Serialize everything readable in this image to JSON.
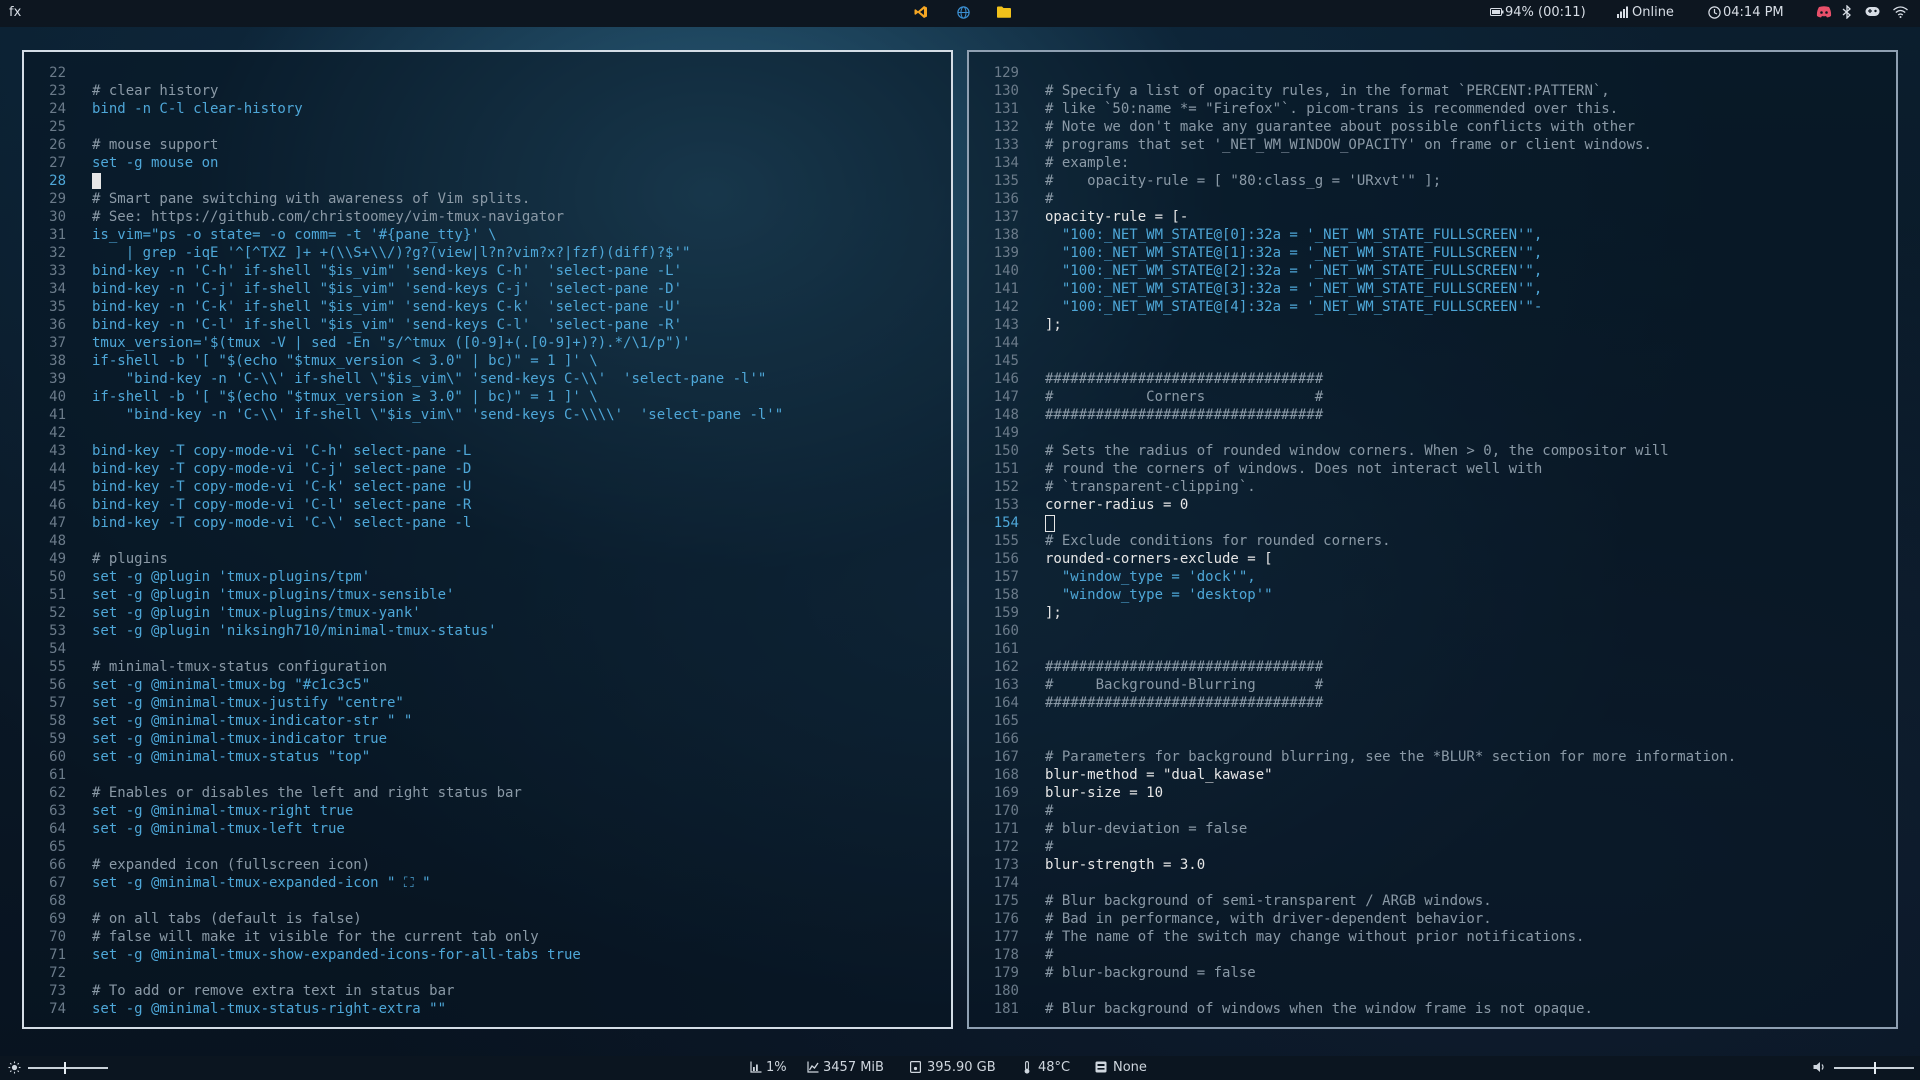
{
  "topbar": {
    "app_label": "fx",
    "battery": "94% (00:11)",
    "network": "Online",
    "clock": "04:14 PM"
  },
  "bottombar": {
    "cpu": "1%",
    "memory": "3457 MiB",
    "disk": "395.90 GB",
    "temp": "48°C",
    "keyboard": "None",
    "brightness_level": 0.45,
    "volume_level": 0.5
  },
  "left_pane": {
    "lines": [
      {
        "n": "22",
        "t": "",
        "c": "kw"
      },
      {
        "n": "23",
        "t": "# clear history",
        "c": "comment"
      },
      {
        "n": "24",
        "t": "bind -n C-l clear-history",
        "c": "cmd"
      },
      {
        "n": "25",
        "t": "",
        "c": "kw"
      },
      {
        "n": "26",
        "t": "# mouse support",
        "c": "comment"
      },
      {
        "n": "27",
        "t": "set -g mouse on",
        "c": "cmd"
      },
      {
        "n": "28",
        "t": "",
        "c": "cursor"
      },
      {
        "n": "29",
        "t": "# Smart pane switching with awareness of Vim splits.",
        "c": "comment"
      },
      {
        "n": "30",
        "t": "# See: https://github.com/christoomey/vim-tmux-navigator",
        "c": "comment"
      },
      {
        "n": "31",
        "t": "is_vim=\"ps -o state= -o comm= -t '#{pane_tty}' \\",
        "c": "mixed"
      },
      {
        "n": "32",
        "t": "    | grep -iqE '^[^TXZ ]+ +(\\\\S+\\\\/)?g?(view|l?n?vim?x?|fzf)(diff)?$'\"",
        "c": "mixed"
      },
      {
        "n": "33",
        "t": "bind-key -n 'C-h' if-shell \"$is_vim\" 'send-keys C-h'  'select-pane -L'",
        "c": "mixed"
      },
      {
        "n": "34",
        "t": "bind-key -n 'C-j' if-shell \"$is_vim\" 'send-keys C-j'  'select-pane -D'",
        "c": "mixed"
      },
      {
        "n": "35",
        "t": "bind-key -n 'C-k' if-shell \"$is_vim\" 'send-keys C-k'  'select-pane -U'",
        "c": "mixed"
      },
      {
        "n": "36",
        "t": "bind-key -n 'C-l' if-shell \"$is_vim\" 'send-keys C-l'  'select-pane -R'",
        "c": "mixed"
      },
      {
        "n": "37",
        "t": "tmux_version='$(tmux -V | sed -En \"s/^tmux ([0-9]+(.[0-9]+)?).*/\\1/p\")'",
        "c": "mixed"
      },
      {
        "n": "38",
        "t": "if-shell -b '[ \"$(echo \"$tmux_version < 3.0\" | bc)\" = 1 ]' \\",
        "c": "mixed"
      },
      {
        "n": "39",
        "t": "    \"bind-key -n 'C-\\\\' if-shell \\\"$is_vim\\\" 'send-keys C-\\\\'  'select-pane -l'\"",
        "c": "mixed"
      },
      {
        "n": "40",
        "t": "if-shell -b '[ \"$(echo \"$tmux_version ≥ 3.0\" | bc)\" = 1 ]' \\",
        "c": "mixed"
      },
      {
        "n": "41",
        "t": "    \"bind-key -n 'C-\\\\' if-shell \\\"$is_vim\\\" 'send-keys C-\\\\\\\\'  'select-pane -l'\"",
        "c": "mixed"
      },
      {
        "n": "42",
        "t": "",
        "c": "kw"
      },
      {
        "n": "43",
        "t": "bind-key -T copy-mode-vi 'C-h' select-pane -L",
        "c": "mixed"
      },
      {
        "n": "44",
        "t": "bind-key -T copy-mode-vi 'C-j' select-pane -D",
        "c": "mixed"
      },
      {
        "n": "45",
        "t": "bind-key -T copy-mode-vi 'C-k' select-pane -U",
        "c": "mixed"
      },
      {
        "n": "46",
        "t": "bind-key -T copy-mode-vi 'C-l' select-pane -R",
        "c": "mixed"
      },
      {
        "n": "47",
        "t": "bind-key -T copy-mode-vi 'C-\\' select-pane -l",
        "c": "mixed"
      },
      {
        "n": "48",
        "t": "",
        "c": "kw"
      },
      {
        "n": "49",
        "t": "# plugins",
        "c": "comment"
      },
      {
        "n": "50",
        "t": "set -g @plugin 'tmux-plugins/tpm'",
        "c": "mixed"
      },
      {
        "n": "51",
        "t": "set -g @plugin 'tmux-plugins/tmux-sensible'",
        "c": "mixed"
      },
      {
        "n": "52",
        "t": "set -g @plugin 'tmux-plugins/tmux-yank'",
        "c": "mixed"
      },
      {
        "n": "53",
        "t": "set -g @plugin 'niksingh710/minimal-tmux-status'",
        "c": "mixed"
      },
      {
        "n": "54",
        "t": "",
        "c": "kw"
      },
      {
        "n": "55",
        "t": "# minimal-tmux-status configuration",
        "c": "comment"
      },
      {
        "n": "56",
        "t": "set -g @minimal-tmux-bg \"#c1c3c5\"",
        "c": "mixed"
      },
      {
        "n": "57",
        "t": "set -g @minimal-tmux-justify \"centre\"",
        "c": "mixed"
      },
      {
        "n": "58",
        "t": "set -g @minimal-tmux-indicator-str \" \"",
        "c": "mixed"
      },
      {
        "n": "59",
        "t": "set -g @minimal-tmux-indicator true",
        "c": "mixed"
      },
      {
        "n": "60",
        "t": "set -g @minimal-tmux-status \"top\"",
        "c": "mixed"
      },
      {
        "n": "61",
        "t": "",
        "c": "kw"
      },
      {
        "n": "62",
        "t": "# Enables or disables the left and right status bar",
        "c": "comment"
      },
      {
        "n": "63",
        "t": "set -g @minimal-tmux-right true",
        "c": "mixed"
      },
      {
        "n": "64",
        "t": "set -g @minimal-tmux-left true",
        "c": "mixed"
      },
      {
        "n": "65",
        "t": "",
        "c": "kw"
      },
      {
        "n": "66",
        "t": "# expanded icon (fullscreen icon)",
        "c": "comment"
      },
      {
        "n": "67",
        "t": "set -g @minimal-tmux-expanded-icon \" ⛶ \"",
        "c": "mixed"
      },
      {
        "n": "68",
        "t": "",
        "c": "kw"
      },
      {
        "n": "69",
        "t": "# on all tabs (default is false)",
        "c": "comment"
      },
      {
        "n": "70",
        "t": "# false will make it visible for the current tab only",
        "c": "comment"
      },
      {
        "n": "71",
        "t": "set -g @minimal-tmux-show-expanded-icons-for-all-tabs true",
        "c": "mixed"
      },
      {
        "n": "72",
        "t": "",
        "c": "kw"
      },
      {
        "n": "73",
        "t": "# To add or remove extra text in status bar",
        "c": "comment"
      },
      {
        "n": "74",
        "t": "set -g @minimal-tmux-status-right-extra \"\"",
        "c": "mixed"
      }
    ]
  },
  "right_pane": {
    "lines": [
      {
        "n": "129",
        "t": "",
        "c": "kw"
      },
      {
        "n": "130",
        "t": "# Specify a list of opacity rules, in the format `PERCENT:PATTERN`,",
        "c": "comment"
      },
      {
        "n": "131",
        "t": "# like `50:name *= \"Firefox\"`. picom-trans is recommended over this.",
        "c": "comment"
      },
      {
        "n": "132",
        "t": "# Note we don't make any guarantee about possible conflicts with other",
        "c": "comment"
      },
      {
        "n": "133",
        "t": "# programs that set '_NET_WM_WINDOW_OPACITY' on frame or client windows.",
        "c": "comment"
      },
      {
        "n": "134",
        "t": "# example:",
        "c": "comment"
      },
      {
        "n": "135",
        "t": "#    opacity-rule = [ \"80:class_g = 'URxvt'\" ];",
        "c": "comment"
      },
      {
        "n": "136",
        "t": "#",
        "c": "comment"
      },
      {
        "n": "137",
        "t": "opacity-rule = [-",
        "c": "kw"
      },
      {
        "n": "138",
        "t": "  \"100:_NET_WM_STATE@[0]:32a = '_NET_WM_STATE_FULLSCREEN'\",",
        "c": "str"
      },
      {
        "n": "139",
        "t": "  \"100:_NET_WM_STATE@[1]:32a = '_NET_WM_STATE_FULLSCREEN'\",",
        "c": "str"
      },
      {
        "n": "140",
        "t": "  \"100:_NET_WM_STATE@[2]:32a = '_NET_WM_STATE_FULLSCREEN'\",",
        "c": "str"
      },
      {
        "n": "141",
        "t": "  \"100:_NET_WM_STATE@[3]:32a = '_NET_WM_STATE_FULLSCREEN'\",",
        "c": "str"
      },
      {
        "n": "142",
        "t": "  \"100:_NET_WM_STATE@[4]:32a = '_NET_WM_STATE_FULLSCREEN'\"-",
        "c": "str"
      },
      {
        "n": "143",
        "t": "];",
        "c": "kw"
      },
      {
        "n": "144",
        "t": "",
        "c": "kw"
      },
      {
        "n": "145",
        "t": "",
        "c": "kw"
      },
      {
        "n": "146",
        "t": "#################################",
        "c": "comment"
      },
      {
        "n": "147",
        "t": "#           Corners             #",
        "c": "comment"
      },
      {
        "n": "148",
        "t": "#################################",
        "c": "comment"
      },
      {
        "n": "149",
        "t": "",
        "c": "kw"
      },
      {
        "n": "150",
        "t": "# Sets the radius of rounded window corners. When > 0, the compositor will",
        "c": "comment"
      },
      {
        "n": "151",
        "t": "# round the corners of windows. Does not interact well with",
        "c": "comment"
      },
      {
        "n": "152",
        "t": "# `transparent-clipping`.",
        "c": "comment"
      },
      {
        "n": "153",
        "t": "corner-radius = 0",
        "c": "kw"
      },
      {
        "n": "154",
        "t": "",
        "c": "hollow"
      },
      {
        "n": "155",
        "t": "# Exclude conditions for rounded corners.",
        "c": "comment"
      },
      {
        "n": "156",
        "t": "rounded-corners-exclude = [",
        "c": "kw"
      },
      {
        "n": "157",
        "t": "  \"window_type = 'dock'\",",
        "c": "str"
      },
      {
        "n": "158",
        "t": "  \"window_type = 'desktop'\"",
        "c": "str"
      },
      {
        "n": "159",
        "t": "];",
        "c": "kw"
      },
      {
        "n": "160",
        "t": "",
        "c": "kw"
      },
      {
        "n": "161",
        "t": "",
        "c": "kw"
      },
      {
        "n": "162",
        "t": "#################################",
        "c": "comment"
      },
      {
        "n": "163",
        "t": "#     Background-Blurring       #",
        "c": "comment"
      },
      {
        "n": "164",
        "t": "#################################",
        "c": "comment"
      },
      {
        "n": "165",
        "t": "",
        "c": "kw"
      },
      {
        "n": "166",
        "t": "",
        "c": "kw"
      },
      {
        "n": "167",
        "t": "# Parameters for background blurring, see the *BLUR* section for more information.",
        "c": "comment"
      },
      {
        "n": "168",
        "t": "blur-method = \"dual_kawase\"",
        "c": "kw"
      },
      {
        "n": "169",
        "t": "blur-size = 10",
        "c": "kw"
      },
      {
        "n": "170",
        "t": "#",
        "c": "comment"
      },
      {
        "n": "171",
        "t": "# blur-deviation = false",
        "c": "comment"
      },
      {
        "n": "172",
        "t": "#",
        "c": "comment"
      },
      {
        "n": "173",
        "t": "blur-strength = 3.0",
        "c": "kw"
      },
      {
        "n": "174",
        "t": "",
        "c": "kw"
      },
      {
        "n": "175",
        "t": "# Blur background of semi-transparent / ARGB windows.",
        "c": "comment"
      },
      {
        "n": "176",
        "t": "# Bad in performance, with driver-dependent behavior.",
        "c": "comment"
      },
      {
        "n": "177",
        "t": "# The name of the switch may change without prior notifications.",
        "c": "comment"
      },
      {
        "n": "178",
        "t": "#",
        "c": "comment"
      },
      {
        "n": "179",
        "t": "# blur-background = false",
        "c": "comment"
      },
      {
        "n": "180",
        "t": "",
        "c": "kw"
      },
      {
        "n": "181",
        "t": "# Blur background of windows when the window frame is not opaque.",
        "c": "comment"
      }
    ]
  },
  "colors": {
    "accent": "#4ea7d8",
    "comment": "#8a99a6",
    "text": "#e6e6e6",
    "vscode_icon": "#f5a623",
    "folder_icon": "#f2c21b",
    "globe_icon": "#3b8fd1"
  }
}
